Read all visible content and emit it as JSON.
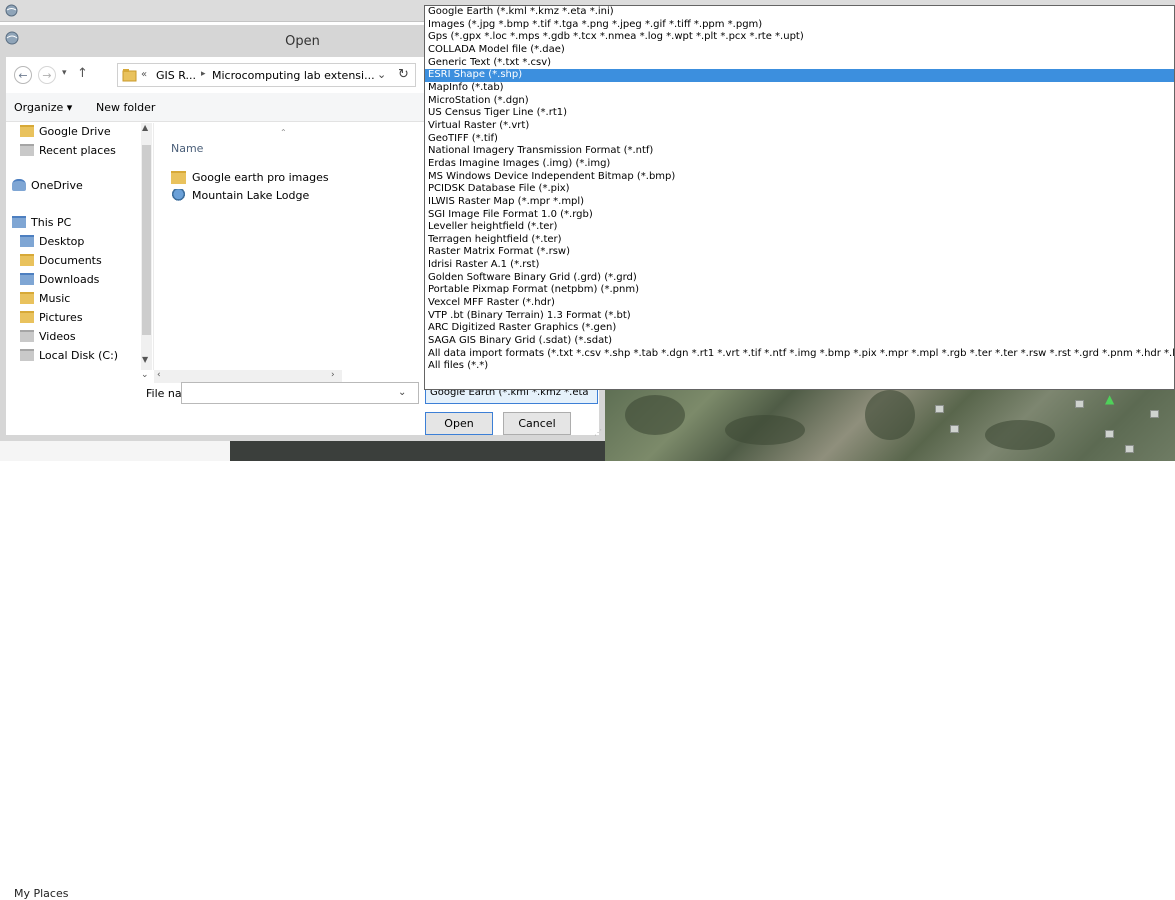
{
  "background": {
    "my_places_label": "My Places"
  },
  "dialog": {
    "title": "Open",
    "address": {
      "crumb_1": "GIS R...",
      "crumb_2": "Microcomputing lab extensi..."
    },
    "toolbar": {
      "organize": "Organize ▾",
      "new_folder": "New folder"
    },
    "nav_items": [
      {
        "label": "Google Drive",
        "icon": "folder-icon"
      },
      {
        "label": "Recent places",
        "icon": "recent-places-icon"
      },
      {
        "label": "OneDrive",
        "icon": "onedrive-icon"
      },
      {
        "label": "This PC",
        "icon": "computer-icon"
      },
      {
        "label": "Desktop",
        "icon": "folder-icon"
      },
      {
        "label": "Documents",
        "icon": "documents-icon"
      },
      {
        "label": "Downloads",
        "icon": "folder-icon"
      },
      {
        "label": "Music",
        "icon": "folder-icon"
      },
      {
        "label": "Pictures",
        "icon": "folder-icon"
      },
      {
        "label": "Videos",
        "icon": "folder-icon"
      },
      {
        "label": "Local Disk (C:)",
        "icon": "drive-icon"
      }
    ],
    "column_name": "Name",
    "files": [
      {
        "name": "Google earth pro images",
        "icon": "folder-icon"
      },
      {
        "name": "Mountain Lake Lodge",
        "icon": "kml-file-icon"
      }
    ],
    "file_name_label": "File name:",
    "file_name_value": "",
    "file_type_selected": "Google Earth (*.kml *.kmz *.eta",
    "open_button": "Open",
    "cancel_button": "Cancel"
  },
  "file_type_options": [
    "Google Earth (*.kml *.kmz *.eta *.ini)",
    "Images (*.jpg *.bmp *.tif *.tga *.png *.jpeg *.gif *.tiff *.ppm *.pgm)",
    "Gps (*.gpx *.loc *.mps *.gdb *.tcx *.nmea *.log *.wpt *.plt *.pcx *.rte *.upt)",
    "COLLADA Model file (*.dae)",
    "Generic Text (*.txt *.csv)",
    "ESRI Shape (*.shp)",
    "MapInfo (*.tab)",
    "MicroStation (*.dgn)",
    "US Census Tiger Line (*.rt1)",
    "Virtual Raster (*.vrt)",
    "GeoTIFF (*.tif)",
    "National Imagery Transmission Format (*.ntf)",
    "Erdas Imagine Images (.img) (*.img)",
    "MS Windows Device Independent Bitmap (*.bmp)",
    "PCIDSK Database File (*.pix)",
    "ILWIS Raster Map (*.mpr *.mpl)",
    "SGI Image File Format 1.0 (*.rgb)",
    "Leveller heightfield (*.ter)",
    "Terragen heightfield (*.ter)",
    "Raster Matrix Format (*.rsw)",
    "Idrisi Raster A.1 (*.rst)",
    "Golden Software Binary Grid (.grd) (*.grd)",
    "Portable Pixmap Format (netpbm) (*.pnm)",
    "Vexcel MFF Raster (*.hdr)",
    "VTP .bt (Binary Terrain) 1.3 Format (*.bt)",
    "ARC Digitized Raster Graphics (*.gen)",
    "SAGA GIS Binary Grid (.sdat) (*.sdat)",
    "All data import formats (*.txt *.csv *.shp *.tab *.dgn *.rt1 *.vrt *.tif *.ntf *.img *.bmp *.pix *.mpr *.mpl *.rgb *.ter *.ter *.rsw *.rst *.grd *.pnm *.hdr *.bt *.gen *.sdat",
    "All files (*.*)"
  ],
  "selected_option": "ESRI Shape (*.shp)",
  "colors": {
    "selection": "#3c8fde",
    "accent_border": "#3c7fd6"
  }
}
